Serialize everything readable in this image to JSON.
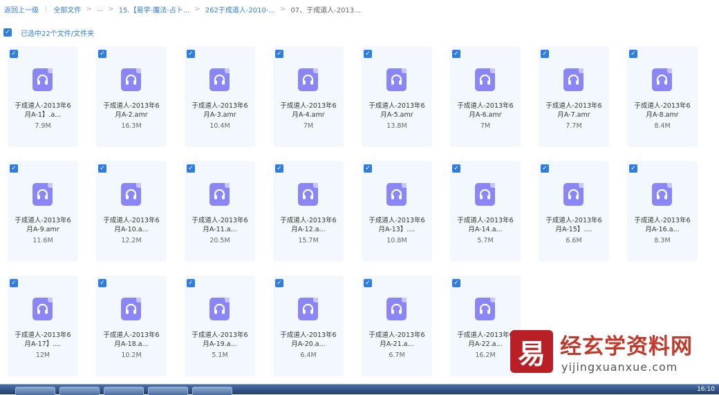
{
  "breadcrumb": {
    "back": "返回上一级",
    "all_files": "全部文件",
    "ellipsis": "...",
    "folder_1": "15.【易学-魔法-占卜...",
    "folder_2": "262于成道人-2010-...",
    "current": "07、于成道人-2013..."
  },
  "selection": {
    "label": "已选中22个文件/文件夹",
    "checkmark": "✓"
  },
  "icon_type": "audio-file-icon",
  "files": [
    {
      "name": "于成道人-2013年6\n月A-1】.a...",
      "size": "7.9M"
    },
    {
      "name": "于成道人-2013年6\n月A-2.amr",
      "size": "16.3M"
    },
    {
      "name": "于成道人-2013年6\n月A-3.amr",
      "size": "10.4M"
    },
    {
      "name": "于成道人-2013年6\n月A-4.amr",
      "size": "7M"
    },
    {
      "name": "于成道人-2013年6\n月A-5.amr",
      "size": "13.8M"
    },
    {
      "name": "于成道人-2013年6\n月A-6.amr",
      "size": "7M"
    },
    {
      "name": "于成道人-2013年6\n月A-7.amr",
      "size": "7.7M"
    },
    {
      "name": "于成道人-2013年6\n月A-8.amr",
      "size": "8.4M"
    },
    {
      "name": "于成道人-2013年6\n月A-9.amr",
      "size": "11.6M"
    },
    {
      "name": "于成道人-2013年6\n月A-10.a...",
      "size": "12.2M"
    },
    {
      "name": "于成道人-2013年6\n月A-11.a...",
      "size": "20.5M"
    },
    {
      "name": "于成道人-2013年6\n月A-12.a...",
      "size": "15.7M"
    },
    {
      "name": "于成道人-2013年6\n月A-13】....",
      "size": "10.8M"
    },
    {
      "name": "于成道人-2013年6\n月A-14.a...",
      "size": "5.7M"
    },
    {
      "name": "于成道人-2013年6\n月A-15】....",
      "size": "6.6M"
    },
    {
      "name": "于成道人-2013年6\n月A-16.a...",
      "size": "8.3M"
    },
    {
      "name": "于成道人-2013年6\n月A-17】....",
      "size": "12M"
    },
    {
      "name": "于成道人-2013年6\n月A-18.a...",
      "size": "10.2M"
    },
    {
      "name": "于成道人-2013年6\n月A-19.a...",
      "size": "5.1M"
    },
    {
      "name": "于成道人-2013年6\n月A-20.a...",
      "size": "6.4M"
    },
    {
      "name": "于成道人-2013年6\n月A-21.a...",
      "size": "6.7M"
    },
    {
      "name": "于成道人-2013年6\n月A-22.a...",
      "size": "16.2M"
    }
  ],
  "watermark": {
    "logo_char": "易",
    "title": "经玄学资料网",
    "url": "yijingxuanxue.com"
  },
  "taskbar": {
    "clock": "16:10"
  },
  "colors": {
    "accent": "#2f7de1",
    "card_bg": "#f3f8ff",
    "icon": "#8b86f6"
  }
}
